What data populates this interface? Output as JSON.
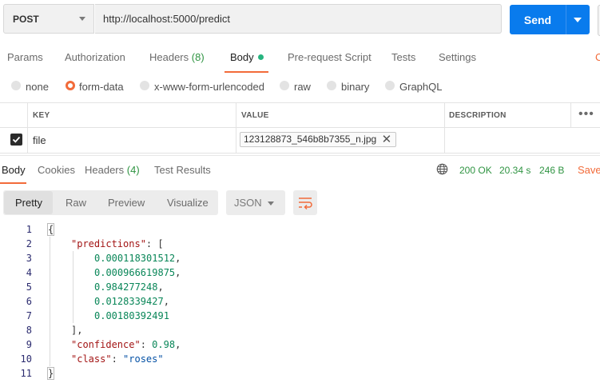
{
  "request": {
    "method": "POST",
    "url": "http://localhost:5000/predict",
    "send_label": "Send"
  },
  "request_tabs": [
    {
      "label": "Params"
    },
    {
      "label": "Authorization"
    },
    {
      "label": "Headers",
      "count": "(8)"
    },
    {
      "label": "Body"
    },
    {
      "label": "Pre-request Script"
    },
    {
      "label": "Tests"
    },
    {
      "label": "Settings"
    }
  ],
  "cookies_partial": "C",
  "body_types": [
    {
      "label": "none",
      "selected": false
    },
    {
      "label": "form-data",
      "selected": true
    },
    {
      "label": "x-www-form-urlencoded",
      "selected": false
    },
    {
      "label": "raw",
      "selected": false
    },
    {
      "label": "binary",
      "selected": false
    },
    {
      "label": "GraphQL",
      "selected": false
    }
  ],
  "table": {
    "headers": {
      "key": "KEY",
      "value": "VALUE",
      "description": "DESCRIPTION"
    },
    "rows": [
      {
        "checked": true,
        "key": "file",
        "value": "123128873_546b8b7355_n.jpg",
        "description": ""
      }
    ]
  },
  "response_tabs": [
    {
      "label": "Body"
    },
    {
      "label": "Cookies"
    },
    {
      "label": "Headers",
      "count": "(4)"
    },
    {
      "label": "Test Results"
    }
  ],
  "response_meta": {
    "status": "200 OK",
    "time": "20.34 s",
    "size": "246 B",
    "save_label": "Save"
  },
  "view_modes": [
    "Pretty",
    "Raw",
    "Preview",
    "Visualize"
  ],
  "format": "JSON",
  "icons": {
    "method_dropdown": "chevron-down-icon",
    "send_dropdown": "chevron-down-icon",
    "more": "more-horizontal-icon",
    "globe": "globe-icon",
    "wrap": "wrap-lines-icon",
    "remove_file": "close-icon",
    "checkbox": "checkmark-icon"
  },
  "colors": {
    "accent": "#f26b3a",
    "send": "#097bed",
    "success": "#2f9442"
  },
  "code": {
    "line_numbers": [
      "1",
      "2",
      "3",
      "4",
      "5",
      "6",
      "7",
      "8",
      "9",
      "10",
      "11"
    ],
    "open_brace": "{",
    "predictions_key": "\"predictions\"",
    "predictions": [
      "0.000118301512",
      "0.000966619875",
      "0.984277248",
      "0.0128339427",
      "0.00180392491"
    ],
    "confidence_key": "\"confidence\"",
    "confidence_value": "0.98",
    "class_key": "\"class\"",
    "class_value": "\"roses\"",
    "close_brace": "}"
  }
}
